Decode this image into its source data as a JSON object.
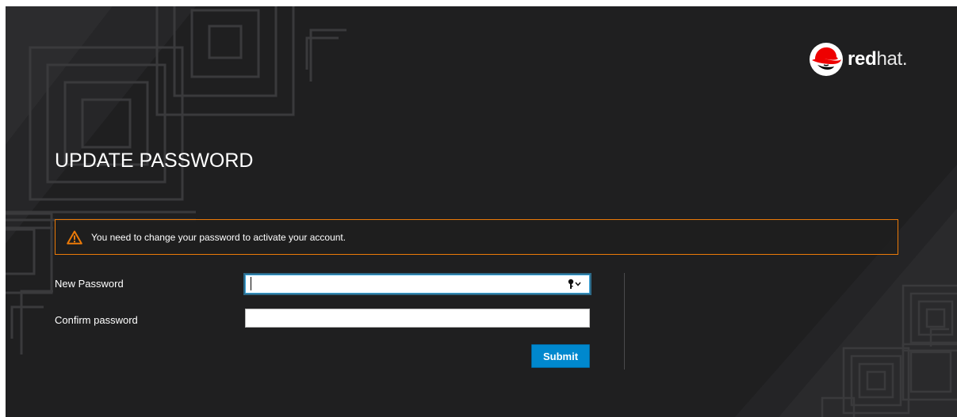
{
  "brand": {
    "name_bold": "red",
    "name_light": "hat",
    "trademark": ".",
    "logo_icon": "redhat-shadowman-icon",
    "accent_color": "#ee0000"
  },
  "page": {
    "title": "UPDATE PASSWORD",
    "background_color": "#1f1f20"
  },
  "alert": {
    "icon": "warning-triangle-icon",
    "message": "You need to change your password to activate your account.",
    "border_color": "#ec7a08"
  },
  "form": {
    "new_password": {
      "label": "New Password",
      "value": "",
      "placeholder": "",
      "focused": true,
      "autofill_icon": "key-autofill-icon"
    },
    "confirm_password": {
      "label": "Confirm password",
      "value": "",
      "placeholder": ""
    },
    "submit_label": "Submit",
    "submit_color": "#0088ce"
  }
}
